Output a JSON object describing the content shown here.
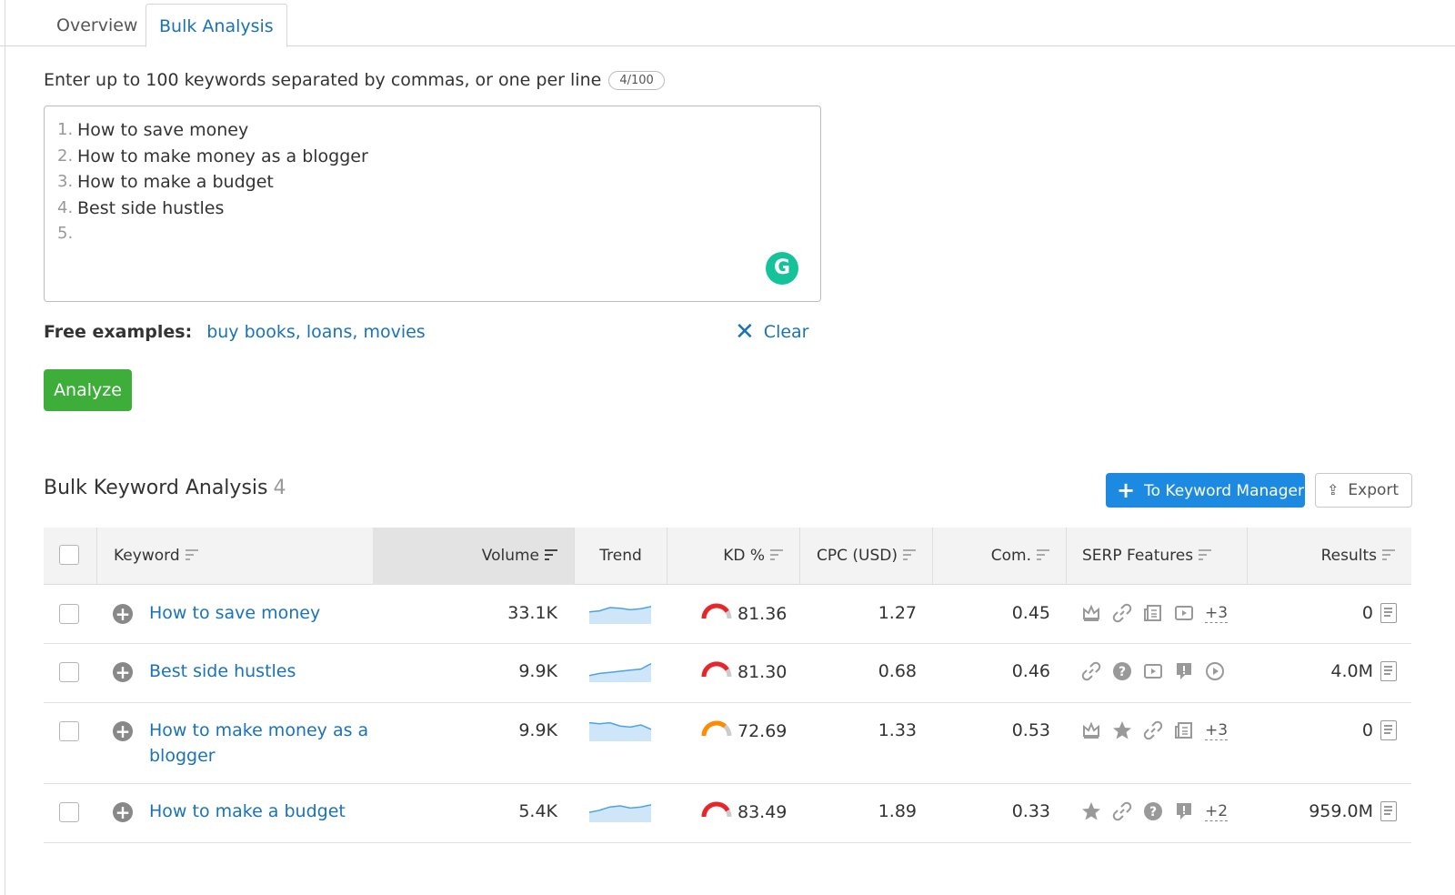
{
  "tabs": [
    {
      "label": "Overview"
    },
    {
      "label": "Bulk Analysis"
    }
  ],
  "input": {
    "instruction": "Enter up to 100 keywords separated by commas, or one per line",
    "count_badge": "4/100",
    "lines": [
      {
        "num": "1.",
        "text": "How to save money"
      },
      {
        "num": "2.",
        "text": "How to make money as a blogger"
      },
      {
        "num": "3.",
        "text": "How to make a budget"
      },
      {
        "num": "4.",
        "text": "Best side hustles"
      },
      {
        "num": "5.",
        "text": ""
      }
    ],
    "grammarly_glyph": "G"
  },
  "examples": {
    "label": "Free examples:",
    "links": "buy books, loans, movies",
    "clear_label": "Clear"
  },
  "analyze_label": "Analyze",
  "results": {
    "title": "Bulk Keyword Analysis",
    "count": "4",
    "km_button": "To Keyword Manager",
    "export_button": "Export"
  },
  "table": {
    "headers": {
      "keyword": "Keyword",
      "volume": "Volume",
      "trend": "Trend",
      "kd": "KD %",
      "cpc": "CPC (USD)",
      "com": "Com.",
      "serp": "SERP Features",
      "results": "Results"
    },
    "rows": [
      {
        "keyword": "How to save money",
        "volume": "33.1K",
        "trend": [
          0.55,
          0.6,
          0.75,
          0.72,
          0.65,
          0.7,
          0.8
        ],
        "kd": "81.36",
        "kd_color": "#e8262a",
        "cpc": "1.27",
        "com": "0.45",
        "serp": [
          "crown-icon",
          "link-icon",
          "news-icon",
          "video-icon"
        ],
        "serp_more": "+3",
        "results": "0"
      },
      {
        "keyword": "Best side hustles",
        "volume": "9.9K",
        "trend": [
          0.3,
          0.4,
          0.45,
          0.5,
          0.55,
          0.6,
          0.85
        ],
        "kd": "81.30",
        "kd_color": "#e8262a",
        "cpc": "0.68",
        "com": "0.46",
        "serp": [
          "link-icon",
          "question-icon",
          "video-icon",
          "faq-icon",
          "play-icon"
        ],
        "serp_more": "",
        "results": "4.0M"
      },
      {
        "keyword": "How to make money as a blogger",
        "volume": "9.9K",
        "trend": [
          0.85,
          0.8,
          0.85,
          0.7,
          0.65,
          0.75,
          0.55
        ],
        "kd": "72.69",
        "kd_color": "#ff8c00",
        "cpc": "1.33",
        "com": "0.53",
        "serp": [
          "crown-icon",
          "star-icon",
          "link-icon",
          "news-icon"
        ],
        "serp_more": "+3",
        "results": "0"
      },
      {
        "keyword": "How to make a budget",
        "volume": "5.4K",
        "trend": [
          0.45,
          0.55,
          0.7,
          0.75,
          0.65,
          0.7,
          0.8
        ],
        "kd": "83.49",
        "kd_color": "#e8262a",
        "cpc": "1.89",
        "com": "0.33",
        "serp": [
          "star-icon",
          "link-icon",
          "question-icon",
          "faq-icon"
        ],
        "serp_more": "+2",
        "results": "959.0M"
      }
    ]
  },
  "colors": {
    "link": "#1a73b8",
    "analyze": "#3eae3a",
    "primary_button": "#1c8ae0",
    "grammarly": "#15c39a"
  }
}
